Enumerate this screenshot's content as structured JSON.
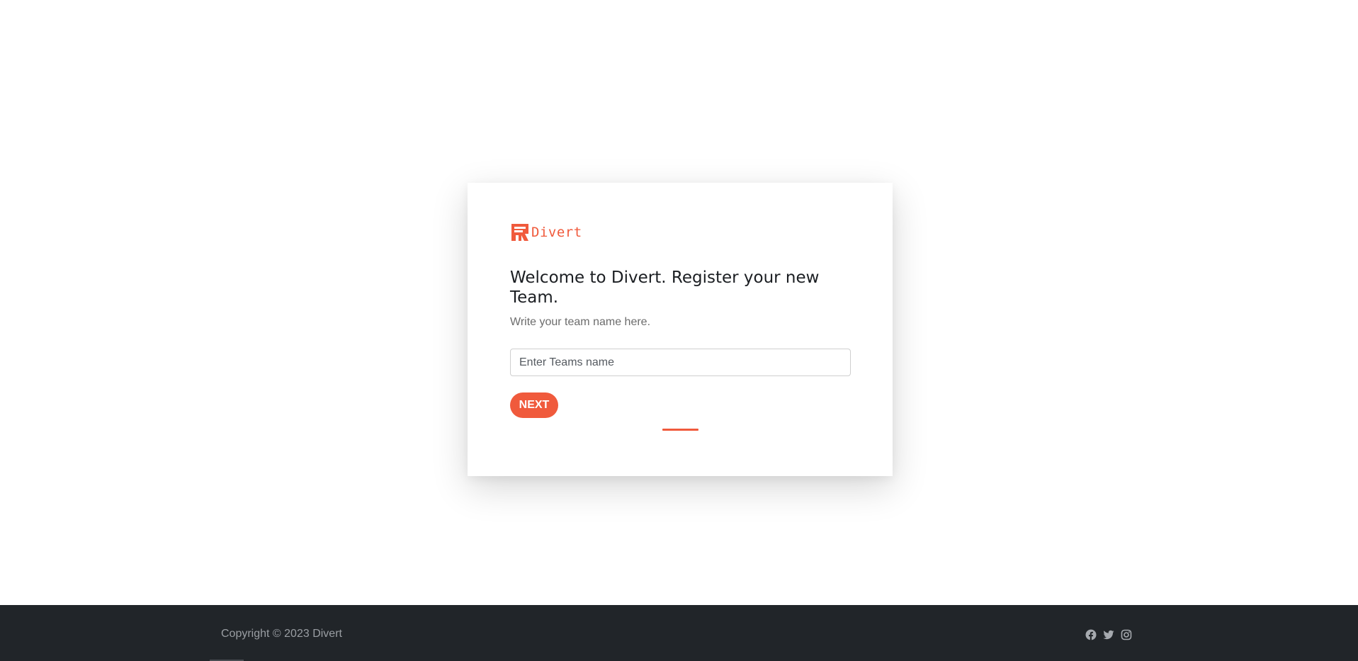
{
  "brand": {
    "name": "Divert",
    "logo_icon": "divert-logo-icon",
    "accent_color": "#f05a3c"
  },
  "register": {
    "title": "Welcome to Divert. Register your new Team.",
    "subtitle": "Write your team name here.",
    "team_input": {
      "value": "",
      "placeholder": "Enter Teams name"
    },
    "next_label": "NEXT"
  },
  "footer": {
    "copyright": "Copyright © 2023 Divert",
    "background_color": "#212529",
    "social_icons": [
      "facebook-icon",
      "twitter-icon",
      "instagram-icon"
    ]
  }
}
